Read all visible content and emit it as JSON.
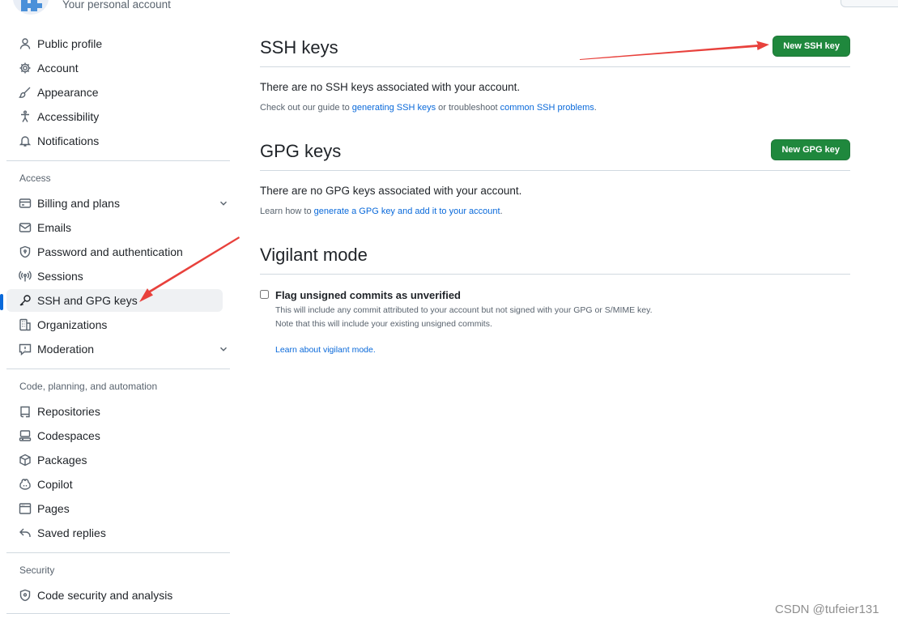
{
  "header": {
    "subtitle": "Your personal account"
  },
  "sidebar": {
    "top_items": [
      {
        "label": "Public profile",
        "icon": "person-icon"
      },
      {
        "label": "Account",
        "icon": "gear-icon"
      },
      {
        "label": "Appearance",
        "icon": "paintbrush-icon"
      },
      {
        "label": "Accessibility",
        "icon": "accessibility-icon"
      },
      {
        "label": "Notifications",
        "icon": "bell-icon"
      }
    ],
    "access": {
      "title": "Access",
      "items": [
        {
          "label": "Billing and plans",
          "icon": "credit-card-icon",
          "expandable": true
        },
        {
          "label": "Emails",
          "icon": "mail-icon"
        },
        {
          "label": "Password and authentication",
          "icon": "shield-lock-icon"
        },
        {
          "label": "Sessions",
          "icon": "broadcast-icon"
        },
        {
          "label": "SSH and GPG keys",
          "icon": "key-icon",
          "active": true
        },
        {
          "label": "Organizations",
          "icon": "organization-icon"
        },
        {
          "label": "Moderation",
          "icon": "report-icon",
          "expandable": true
        }
      ]
    },
    "code": {
      "title": "Code, planning, and automation",
      "items": [
        {
          "label": "Repositories",
          "icon": "repo-icon"
        },
        {
          "label": "Codespaces",
          "icon": "codespaces-icon"
        },
        {
          "label": "Packages",
          "icon": "package-icon"
        },
        {
          "label": "Copilot",
          "icon": "copilot-icon"
        },
        {
          "label": "Pages",
          "icon": "browser-icon"
        },
        {
          "label": "Saved replies",
          "icon": "reply-icon"
        }
      ]
    },
    "security": {
      "title": "Security",
      "items": [
        {
          "label": "Code security and analysis",
          "icon": "codescan-icon"
        }
      ]
    }
  },
  "main": {
    "ssh": {
      "title": "SSH keys",
      "button": "New SSH key",
      "empty_text": "There are no SSH keys associated with your account.",
      "guide_pre": "Check out our guide to ",
      "guide_link1": "generating SSH keys",
      "guide_mid": " or troubleshoot ",
      "guide_link2": "common SSH problems",
      "guide_post": "."
    },
    "gpg": {
      "title": "GPG keys",
      "button": "New GPG key",
      "empty_text": "There are no GPG keys associated with your account.",
      "learn_pre": "Learn how to ",
      "learn_link": "generate a GPG key and add it to your account",
      "learn_post": "."
    },
    "vigilant": {
      "title": "Vigilant mode",
      "checkbox_label": "Flag unsigned commits as unverified",
      "checked": false,
      "desc_line1": "This will include any commit attributed to your account but not signed with your GPG or S/MIME key.",
      "desc_line2": "Note that this will include your existing unsigned commits.",
      "learn_link": "Learn about vigilant mode."
    }
  },
  "annotation_color": "#e8413c",
  "watermark": "CSDN @tufeier131"
}
